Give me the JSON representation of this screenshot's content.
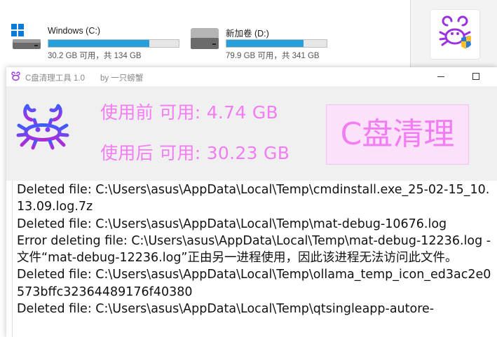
{
  "explorer": {
    "drives": [
      {
        "name": "Windows (C:)",
        "info": "30.2 GB 可用，共 134 GB",
        "used_fraction": 0.775,
        "icon": "windows-drive-icon"
      },
      {
        "name": "新加卷 (D:)",
        "info": "79.9 GB 可用，共 341 GB",
        "used_fraction": 0.766,
        "icon": "hard-drive-icon"
      }
    ]
  },
  "app": {
    "title": "C盘清理工具 1.0",
    "author": "by 一只螃蟹",
    "before_label": "使用前 可用: 4.74 GB",
    "after_label": "使用后 可用: 30.23 GB",
    "clean_button": "C盘清理",
    "accent_color": "#f27cf3",
    "crab_color": "#9b32e0",
    "log": [
      "Deleted file: C:\\Users\\asus\\AppData\\Local\\Temp\\cmdinstall.exe_25-02-15_10.13.09.log.7z",
      "Deleted file: C:\\Users\\asus\\AppData\\Local\\Temp\\mat-debug-10676.log",
      "Error deleting file: C:\\Users\\asus\\AppData\\Local\\Temp\\mat-debug-12236.log - 文件“mat-debug-12236.log”正由另一进程使用，因此该进程无法访问此文件。",
      "Deleted file: C:\\Users\\asus\\AppData\\Local\\Temp\\ollama_temp_icon_ed3ac2e0573bffc32364489176f40380",
      "Deleted file: C:\\Users\\asus\\AppData\\Local\\Temp\\qtsingleapp-autore-"
    ]
  }
}
